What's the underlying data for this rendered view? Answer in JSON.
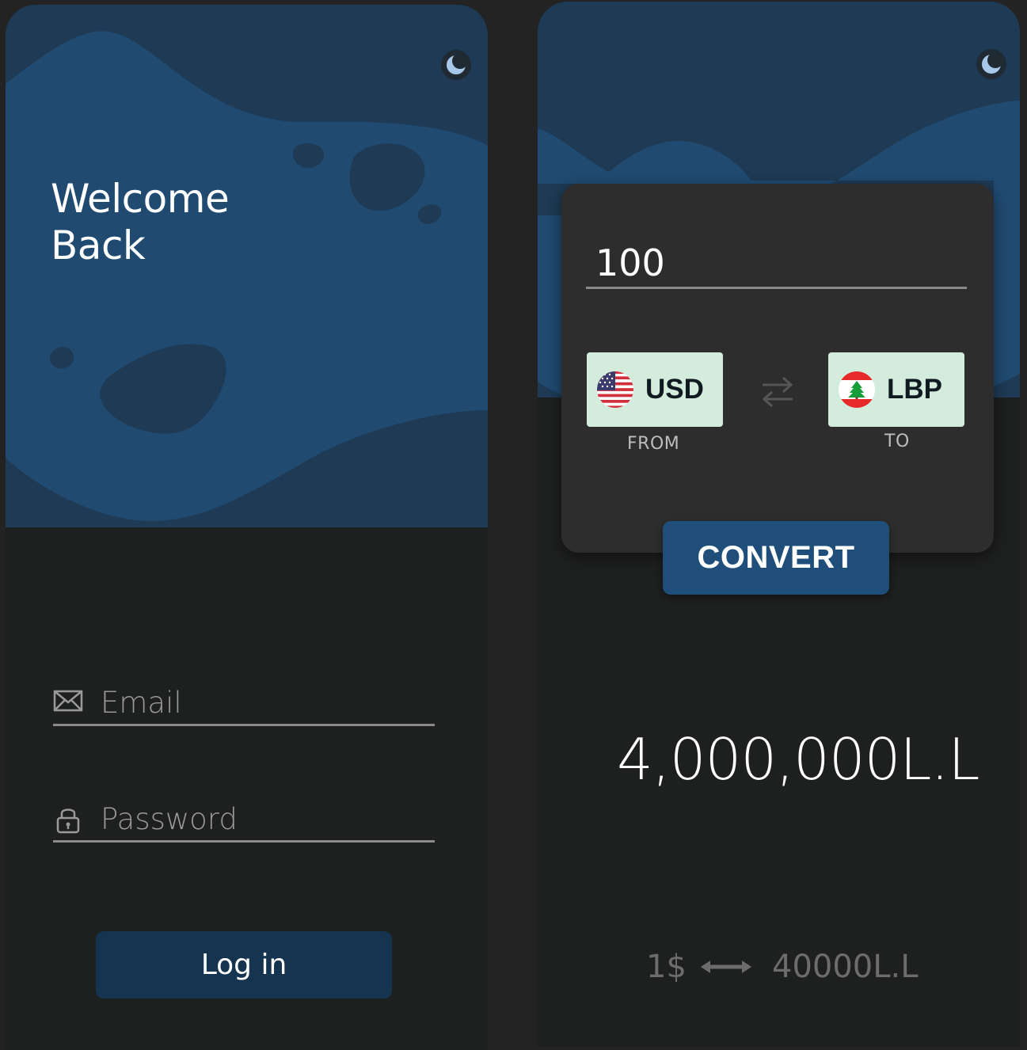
{
  "login": {
    "title_line1": "Welcome",
    "title_line2": "Back",
    "email_placeholder": "Email",
    "password_placeholder": "Password",
    "login_label": "Log in",
    "theme_icon": "moon-icon"
  },
  "converter": {
    "amount_value": "100",
    "from_currency": {
      "code": "USD",
      "caption": "FROM",
      "flag_icon": "us-flag-icon"
    },
    "to_currency": {
      "code": "LBP",
      "caption": "TO",
      "flag_icon": "lebanon-flag-icon"
    },
    "swap_icon": "swap-arrows-icon",
    "convert_label": "CONVERT",
    "result_value": "4,000,000L.L",
    "rate_left": "1$",
    "rate_icon": "double-arrow-icon",
    "rate_right": "40000L.L",
    "theme_icon": "moon-icon"
  },
  "colors": {
    "page_background": "#232323",
    "screen_background": "#1e1f1f",
    "wave_light": "#204a70",
    "wave_dark": "#1e3a54",
    "card_background": "#2d2d2d",
    "currency_button": "#d4ecdb",
    "login_button": "#15344f",
    "convert_button": "#1f4e7a",
    "moon": "#a8c8ea"
  }
}
